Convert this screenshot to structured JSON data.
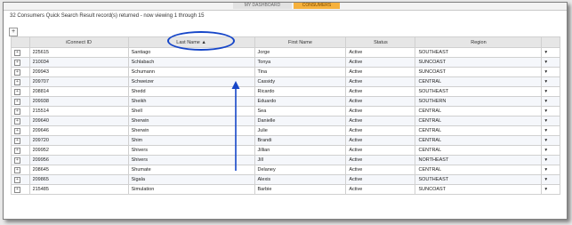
{
  "tabs": [
    {
      "label": "MY DASHBOARD"
    },
    {
      "label": "CONSUMERS"
    }
  ],
  "result_text": "32 Consumers Quick Search Result record(s) returned - now viewing 1 through 15",
  "toolbar": {
    "add_label": "+"
  },
  "columns": [
    "iConnect ID",
    "Last Name",
    "First Name",
    "Status",
    "Region"
  ],
  "sort_indicator": "▲",
  "rows": [
    {
      "id": "225615",
      "last": "Santiago",
      "first": "Jorge",
      "status": "Active",
      "region": "SOUTHEAST"
    },
    {
      "id": "210034",
      "last": "Schlabach",
      "first": "Tonya",
      "status": "Active",
      "region": "SUNCOAST"
    },
    {
      "id": "209943",
      "last": "Schumann",
      "first": "Tina",
      "status": "Active",
      "region": "SUNCOAST"
    },
    {
      "id": "209707",
      "last": "Schweizer",
      "first": "Cassidy",
      "status": "Active",
      "region": "CENTRAL"
    },
    {
      "id": "208814",
      "last": "Shedd",
      "first": "Ricardo",
      "status": "Active",
      "region": "SOUTHEAST"
    },
    {
      "id": "209938",
      "last": "Sheikh",
      "first": "Eduardo",
      "status": "Active",
      "region": "SOUTHERN"
    },
    {
      "id": "215514",
      "last": "Shell",
      "first": "Sea",
      "status": "Active",
      "region": "CENTRAL"
    },
    {
      "id": "209640",
      "last": "Sherwin",
      "first": "Danielle",
      "status": "Active",
      "region": "CENTRAL"
    },
    {
      "id": "209646",
      "last": "Sherwin",
      "first": "Julie",
      "status": "Active",
      "region": "CENTRAL"
    },
    {
      "id": "209720",
      "last": "Shim",
      "first": "Brandi",
      "status": "Active",
      "region": "CENTRAL"
    },
    {
      "id": "209952",
      "last": "Shivers",
      "first": "Jillian",
      "status": "Active",
      "region": "CENTRAL"
    },
    {
      "id": "209956",
      "last": "Shivers",
      "first": "Jill",
      "status": "Active",
      "region": "NORTHEAST"
    },
    {
      "id": "208645",
      "last": "Shumate",
      "first": "Delaney",
      "status": "Active",
      "region": "CENTRAL"
    },
    {
      "id": "209865",
      "last": "Sigala",
      "first": "Alexis",
      "status": "Active",
      "region": "SOUTHEAST"
    },
    {
      "id": "215485",
      "last": "Simulation",
      "first": "Barbie",
      "status": "Active",
      "region": "SUNCOAST"
    }
  ],
  "row_icons": {
    "expand": "plus-box-icon",
    "menu": "dropdown-arrow-icon"
  },
  "annotation_color": "#1646c8"
}
